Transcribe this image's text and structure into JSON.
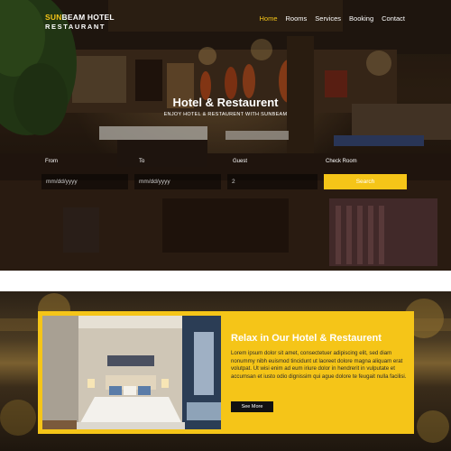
{
  "brand": {
    "name_accent": "SUN",
    "name_rest": "BEAM HOTEL",
    "tagline": "RESTAURANT"
  },
  "nav": {
    "items": [
      {
        "label": "Home",
        "active": true
      },
      {
        "label": "Rooms",
        "active": false
      },
      {
        "label": "Services",
        "active": false
      },
      {
        "label": "Booking",
        "active": false
      },
      {
        "label": "Contact",
        "active": false
      }
    ]
  },
  "hero": {
    "title": "Hotel & Restaurent",
    "subtitle": "ENJOY HOTEL & RESTAURENT WITH SUNBEAM"
  },
  "booking": {
    "from_label": "From",
    "from_placeholder": "mm/dd/yyyy",
    "to_label": "To",
    "to_placeholder": "mm/dd/yyyy",
    "guest_label": "Guest",
    "guest_value": "2",
    "check_label": "Check Room",
    "search_label": "Search"
  },
  "about": {
    "title": "Relax in Our Hotel & Restaurent",
    "body": "Lorem ipsum dolor sit amet, consectetuer adipiscing elit, sed diam nonummy nibh euismod tincidunt ut laoreet dolore magna aliquam erat volutpat. Ut wisi enim ad eum iriure dolor in hendrerit in vulputate et accumsan et iusto odio dignissim qui ague dolore te feugait nulla facilisi.",
    "button_label": "See More"
  },
  "colors": {
    "accent": "#f5c518",
    "dark": "#111111"
  }
}
